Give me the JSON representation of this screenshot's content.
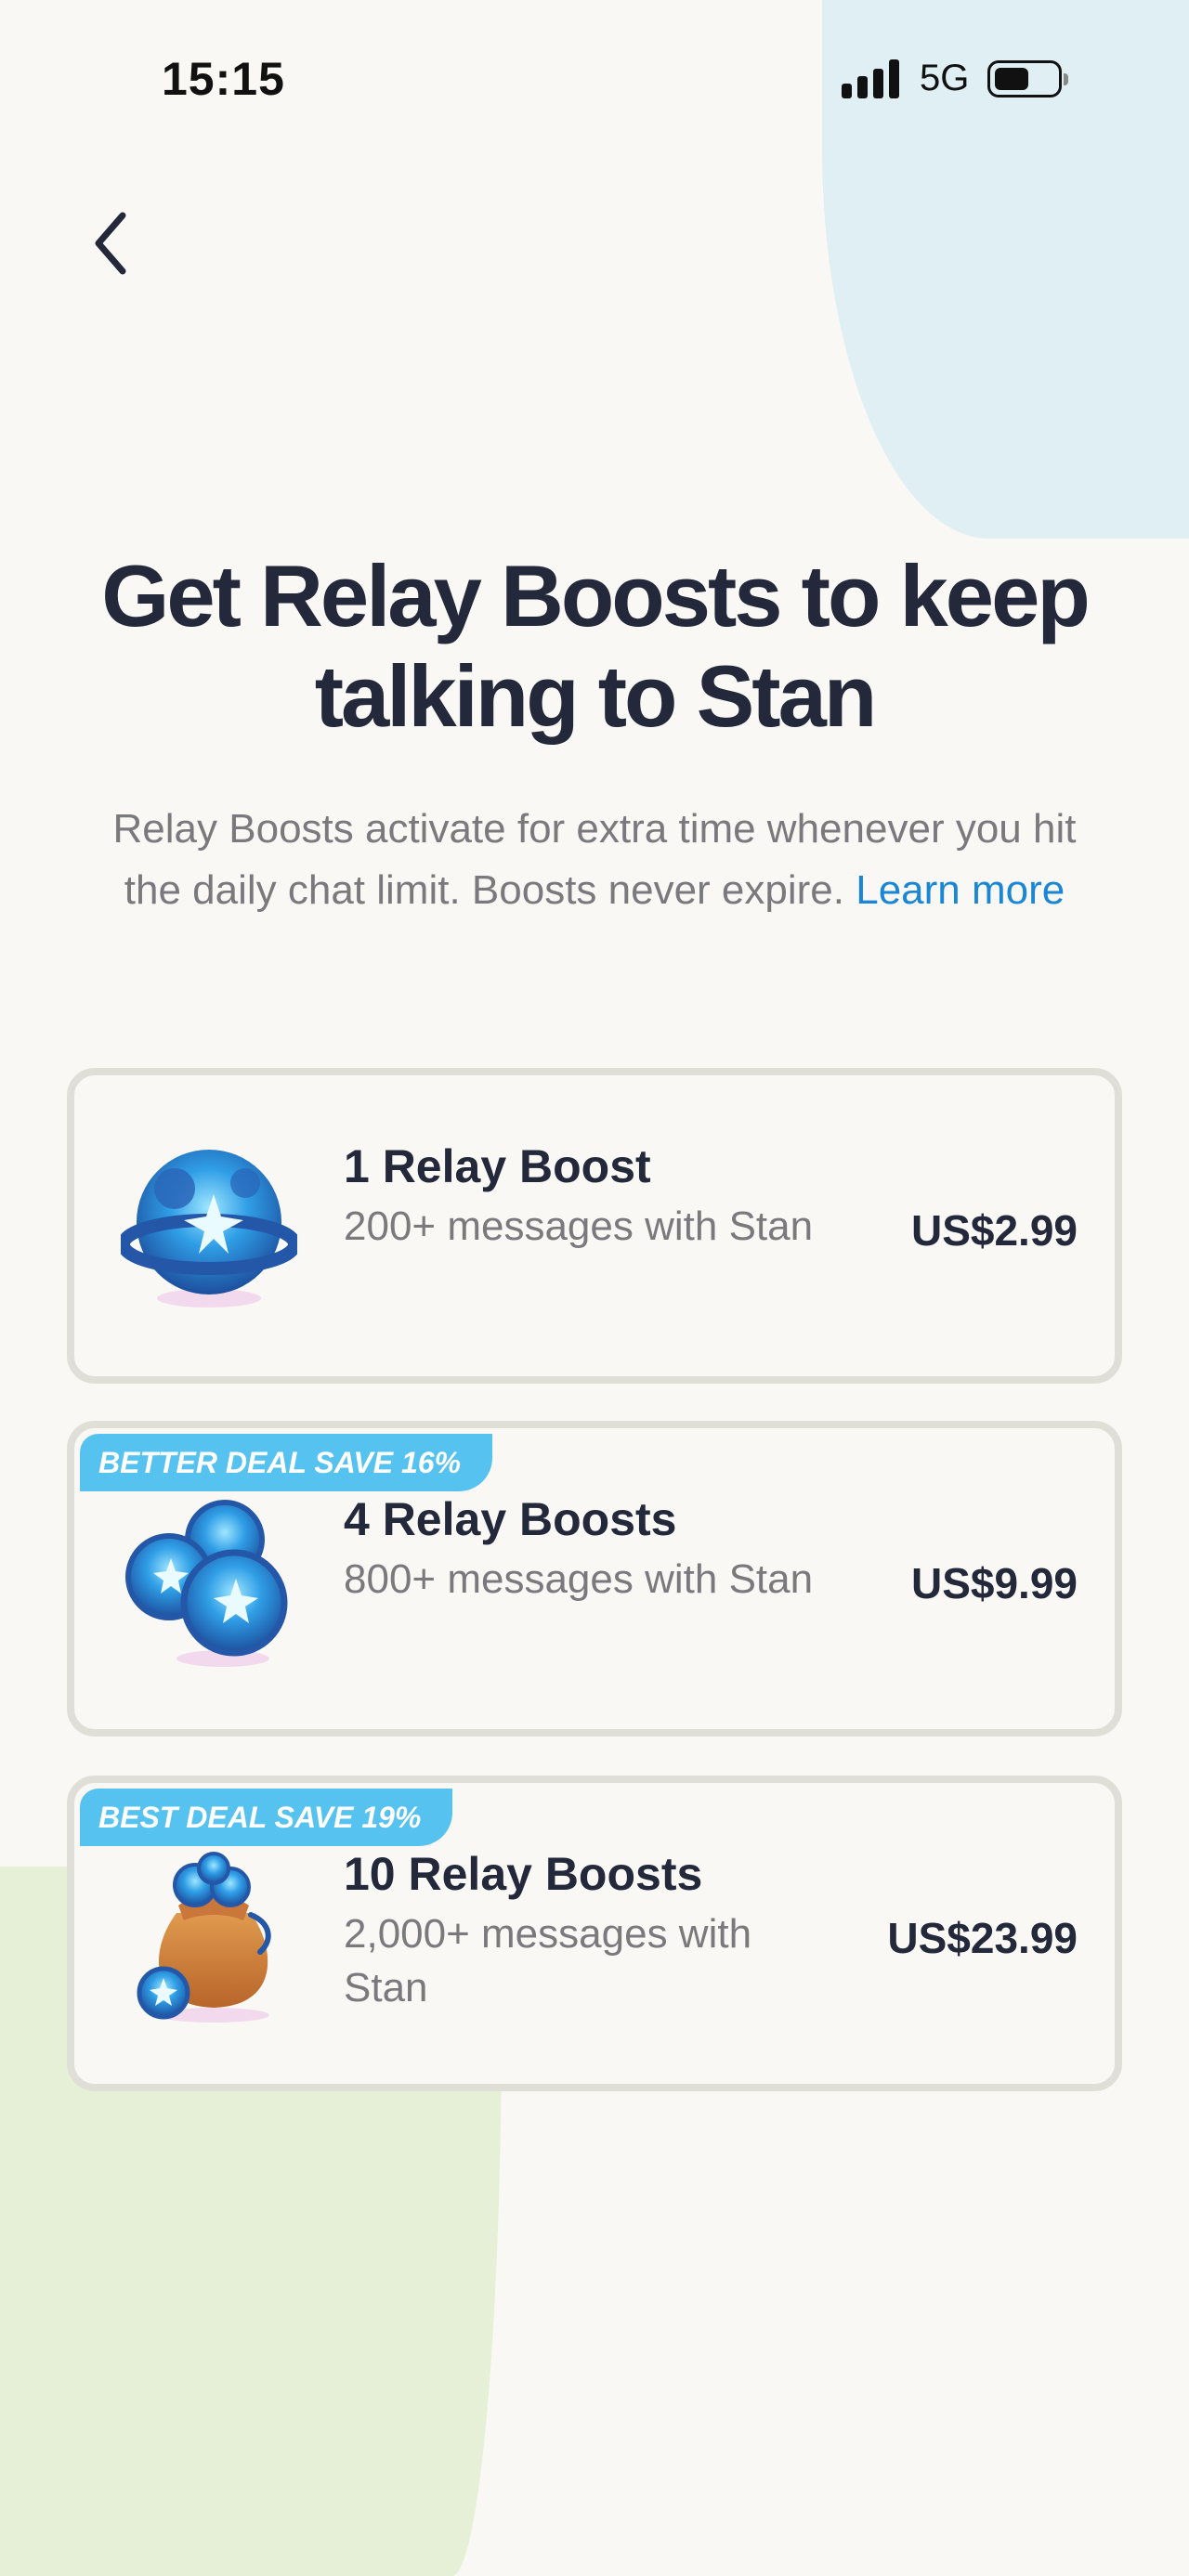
{
  "status_bar": {
    "time": "15:15",
    "network": "5G"
  },
  "header": {
    "back_icon": "chevron-left-icon"
  },
  "headline": {
    "line1": "Get Relay Boosts to keep",
    "line2": "talking to Stan"
  },
  "subtitle": {
    "text": "Relay Boosts activate for extra time whenever you hit the daily chat limit. Boosts never expire.",
    "link_label": "Learn more"
  },
  "offers": [
    {
      "badge": "",
      "title": "1 Relay Boost",
      "description": "200+ messages with Stan",
      "price": "US$2.99",
      "icon": "single-boost-orb-icon"
    },
    {
      "badge": "BETTER DEAL SAVE 16%",
      "title": "4 Relay Boosts",
      "description": "800+ messages with Stan",
      "price": "US$9.99",
      "icon": "boost-orb-cluster-icon"
    },
    {
      "badge": "BEST DEAL SAVE 19%",
      "title": "10 Relay Boosts",
      "description": "2,000+ messages with Stan",
      "price": "US$23.99",
      "icon": "boost-bag-icon"
    }
  ],
  "colors": {
    "accent": "#1a86d6",
    "badge": "#56c2ef",
    "headline": "#23283a",
    "muted_text": "#7a7a7e",
    "card_border": "#e0dfd7",
    "background": "#f9f8f4",
    "blob_blue": "#dfeff4",
    "blob_green": "#e5f0d6"
  }
}
